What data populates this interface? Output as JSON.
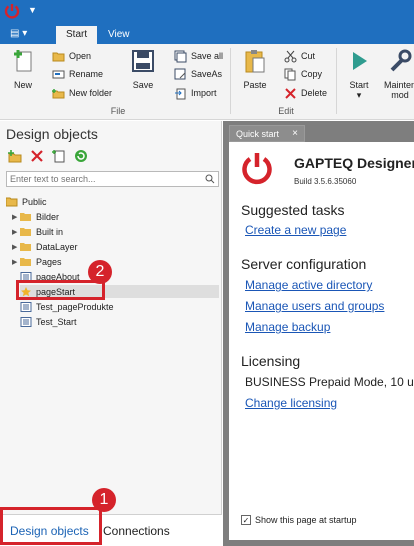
{
  "titlebar": {
    "quick_access": "▼"
  },
  "ribbon_tabs": {
    "file_menu": "▤ ▾",
    "start": "Start",
    "view": "View"
  },
  "ribbon": {
    "new": "New",
    "open": "Open",
    "rename": "Rename",
    "new_folder": "New folder",
    "save": "Save",
    "save_all": "Save all",
    "save_as": "SaveAs",
    "import": "Import",
    "paste": "Paste",
    "cut": "Cut",
    "copy": "Copy",
    "delete": "Delete",
    "start": "Start",
    "maintenance": "Mainten",
    "maintenance_line2": "mod",
    "group_file": "File",
    "group_edit": "Edit"
  },
  "left_panel": {
    "title": "Design objects",
    "search_placeholder": "Enter text to search...",
    "tree": {
      "root": "Public",
      "folders": [
        "Bilder",
        "Built in",
        "DataLayer",
        "Pages"
      ],
      "pages": [
        "pageAbout",
        "pageStart",
        "Test_pageProdukte",
        "Test_Start"
      ]
    },
    "bottom_tabs": {
      "design_objects": "Design objects",
      "connections": "Connections"
    }
  },
  "annotations": {
    "badge_1": "1",
    "badge_2": "2"
  },
  "quick_start": {
    "tab_label": "Quick start",
    "tab_close": "×",
    "app_name": "GAPTEQ Designer",
    "build": "Build 3.5.6.35060",
    "suggested_heading": "Suggested tasks",
    "create_page": "Create a new page",
    "server_heading": "Server configuration",
    "manage_directory": "Manage active directory",
    "manage_users": "Manage users and groups",
    "manage_backup": "Manage backup",
    "licensing_heading": "Licensing",
    "license_mode": "BUSINESS Prepaid Mode, 10 u",
    "change_licensing": "Change licensing",
    "show_at_startup": "Show this page at startup",
    "show_at_startup_checked": "✓"
  },
  "colors": {
    "brand_blue": "#1f6fbf",
    "logo_red": "#d5232b",
    "annotation_red": "#d5232b",
    "link_blue": "#1a56b6"
  }
}
